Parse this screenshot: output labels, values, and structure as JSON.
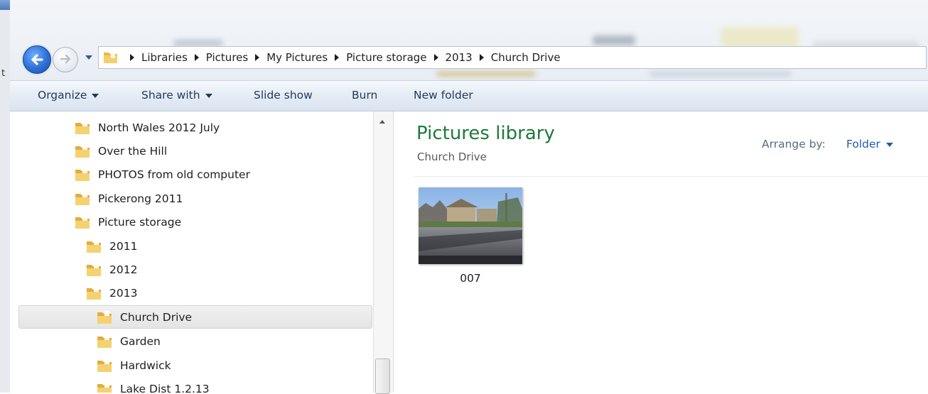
{
  "window": {
    "background_letter": "t"
  },
  "address_bar": {
    "crumbs": [
      "Libraries",
      "Pictures",
      "My Pictures",
      "Picture storage",
      "2013",
      "Church Drive"
    ]
  },
  "toolbar": {
    "organize": "Organize",
    "share_with": "Share with",
    "slide_show": "Slide show",
    "burn": "Burn",
    "new_folder": "New folder"
  },
  "nav": {
    "items": [
      {
        "label": "North Wales 2012 July",
        "level": 0
      },
      {
        "label": "Over the Hill",
        "level": 0
      },
      {
        "label": "PHOTOS from old computer",
        "level": 0
      },
      {
        "label": "Pickerong 2011",
        "level": 0
      },
      {
        "label": "Picture storage",
        "level": 0
      },
      {
        "label": "2011",
        "level": 1
      },
      {
        "label": "2012",
        "level": 1
      },
      {
        "label": "2013",
        "level": 1
      },
      {
        "label": "Church Drive",
        "level": 2,
        "selected": true
      },
      {
        "label": "Garden",
        "level": 2
      },
      {
        "label": "Hardwick",
        "level": 2
      },
      {
        "label": "Lake Dist 1.2.13",
        "level": 2
      }
    ]
  },
  "content": {
    "title": "Pictures library",
    "subtitle": "Church Drive",
    "arrange_label": "Arrange by:",
    "arrange_value": "Folder",
    "files": [
      {
        "name": "007"
      }
    ]
  },
  "colors": {
    "title_green": "#1e7a3c",
    "link_blue": "#1c5bb5",
    "toolbar_text": "#1e395b"
  }
}
